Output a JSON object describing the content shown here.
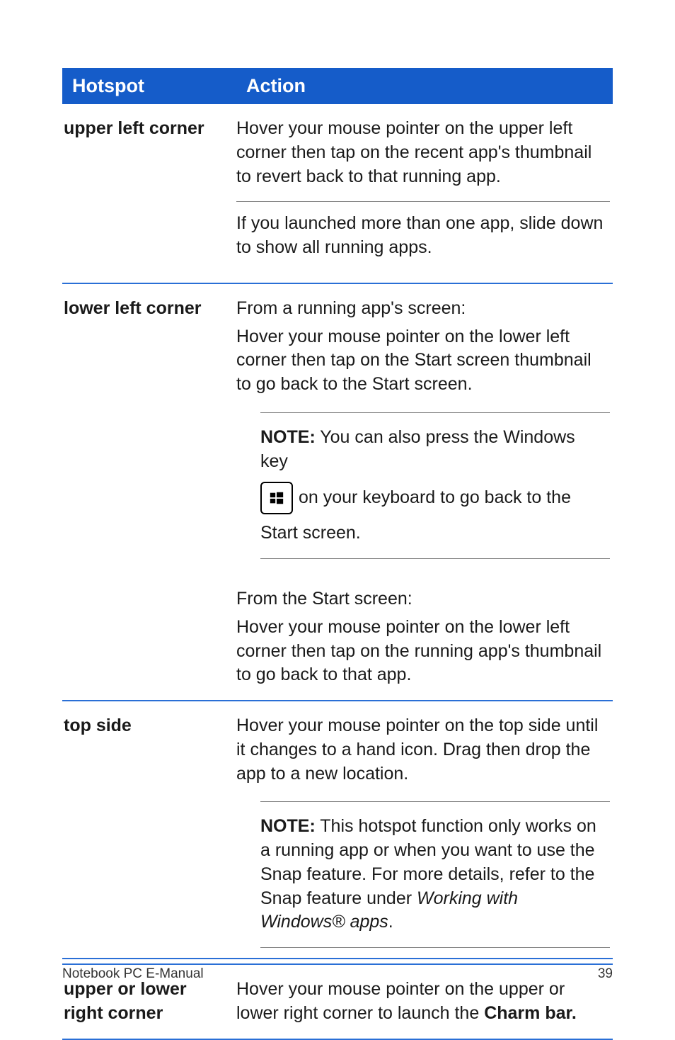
{
  "table": {
    "headers": {
      "hotspot": "Hotspot",
      "action": "Action"
    },
    "rows": {
      "upper_left": {
        "label": "upper left corner",
        "p1": "Hover your mouse pointer on the upper left corner then tap on the recent app's thumbnail to revert back to that running app.",
        "p2": "If you launched more than one app, slide down to show all running apps."
      },
      "lower_left": {
        "label": "lower left corner",
        "p1": "From a running app's screen:",
        "p2": "Hover your mouse pointer on the lower left corner then tap on the Start screen thumbnail to go back to the Start screen.",
        "note": {
          "label": "NOTE:",
          "line1": " You can also press the Windows key",
          "key_icon": "windows-logo",
          "line2": "on your keyboard to go back to the",
          "line3": "Start screen."
        },
        "p3": "From the Start screen:",
        "p4": "Hover your mouse pointer on the lower left corner then tap on the running app's thumbnail to go back to that app."
      },
      "top_side": {
        "label": "top side",
        "p1": "Hover your mouse pointer on the top side until it changes to a hand icon. Drag then drop the app to a new location.",
        "note": {
          "label": "NOTE:",
          "body_a": " This hotspot function only works on a running app or when you want to use the Snap feature. For more details, refer to the Snap feature under ",
          "italic": "Working with Windows® apps",
          "body_b": "."
        }
      },
      "upper_lower_right": {
        "label": "upper or lower right corner",
        "body_a": "Hover your mouse pointer on the upper or lower right corner to launch the ",
        "bold": "Charm bar."
      }
    }
  },
  "footer": {
    "left": "Notebook PC E-Manual",
    "right": "39"
  }
}
